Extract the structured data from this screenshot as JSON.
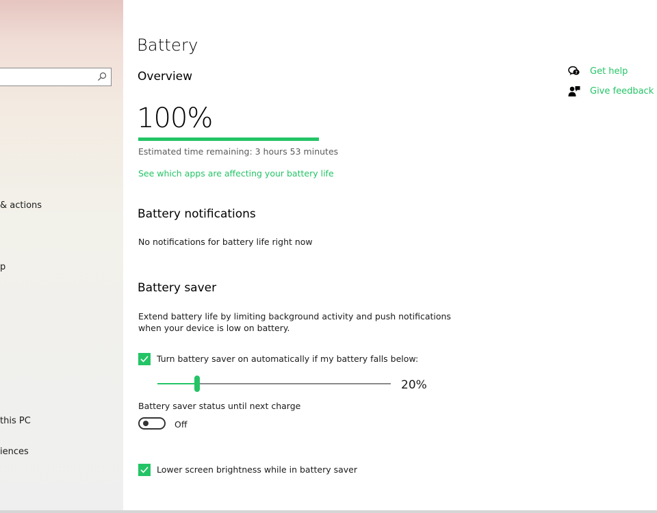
{
  "sidebar": {
    "items": [
      {
        "label": "& actions"
      },
      {
        "label": "p"
      },
      {
        "label": "this PC"
      },
      {
        "label": "iences"
      }
    ]
  },
  "page": {
    "title": "Battery",
    "overview_heading": "Overview",
    "battery_percent": "100%",
    "battery_level": 100,
    "estimated_time": "Estimated time remaining:  3 hours 53 minutes",
    "apps_link": "See which apps are affecting your battery life",
    "notifications_heading": "Battery notifications",
    "notifications_text": "No notifications for battery life right now",
    "saver_heading": "Battery saver",
    "saver_desc_line1": "Extend battery life by limiting background activity and push notifications",
    "saver_desc_line2": "when your device is low on battery.",
    "auto_saver_label": "Turn battery saver on automatically if my battery falls below:",
    "auto_saver_checked": true,
    "threshold_value": "20%",
    "threshold_percent": 20,
    "status_label": "Battery saver status until next charge",
    "toggle_state": "Off",
    "brightness_label": "Lower screen brightness while in battery saver",
    "brightness_checked": true
  },
  "help": {
    "get_help": "Get help",
    "give_feedback": "Give feedback"
  },
  "colors": {
    "accent": "#24c466"
  }
}
